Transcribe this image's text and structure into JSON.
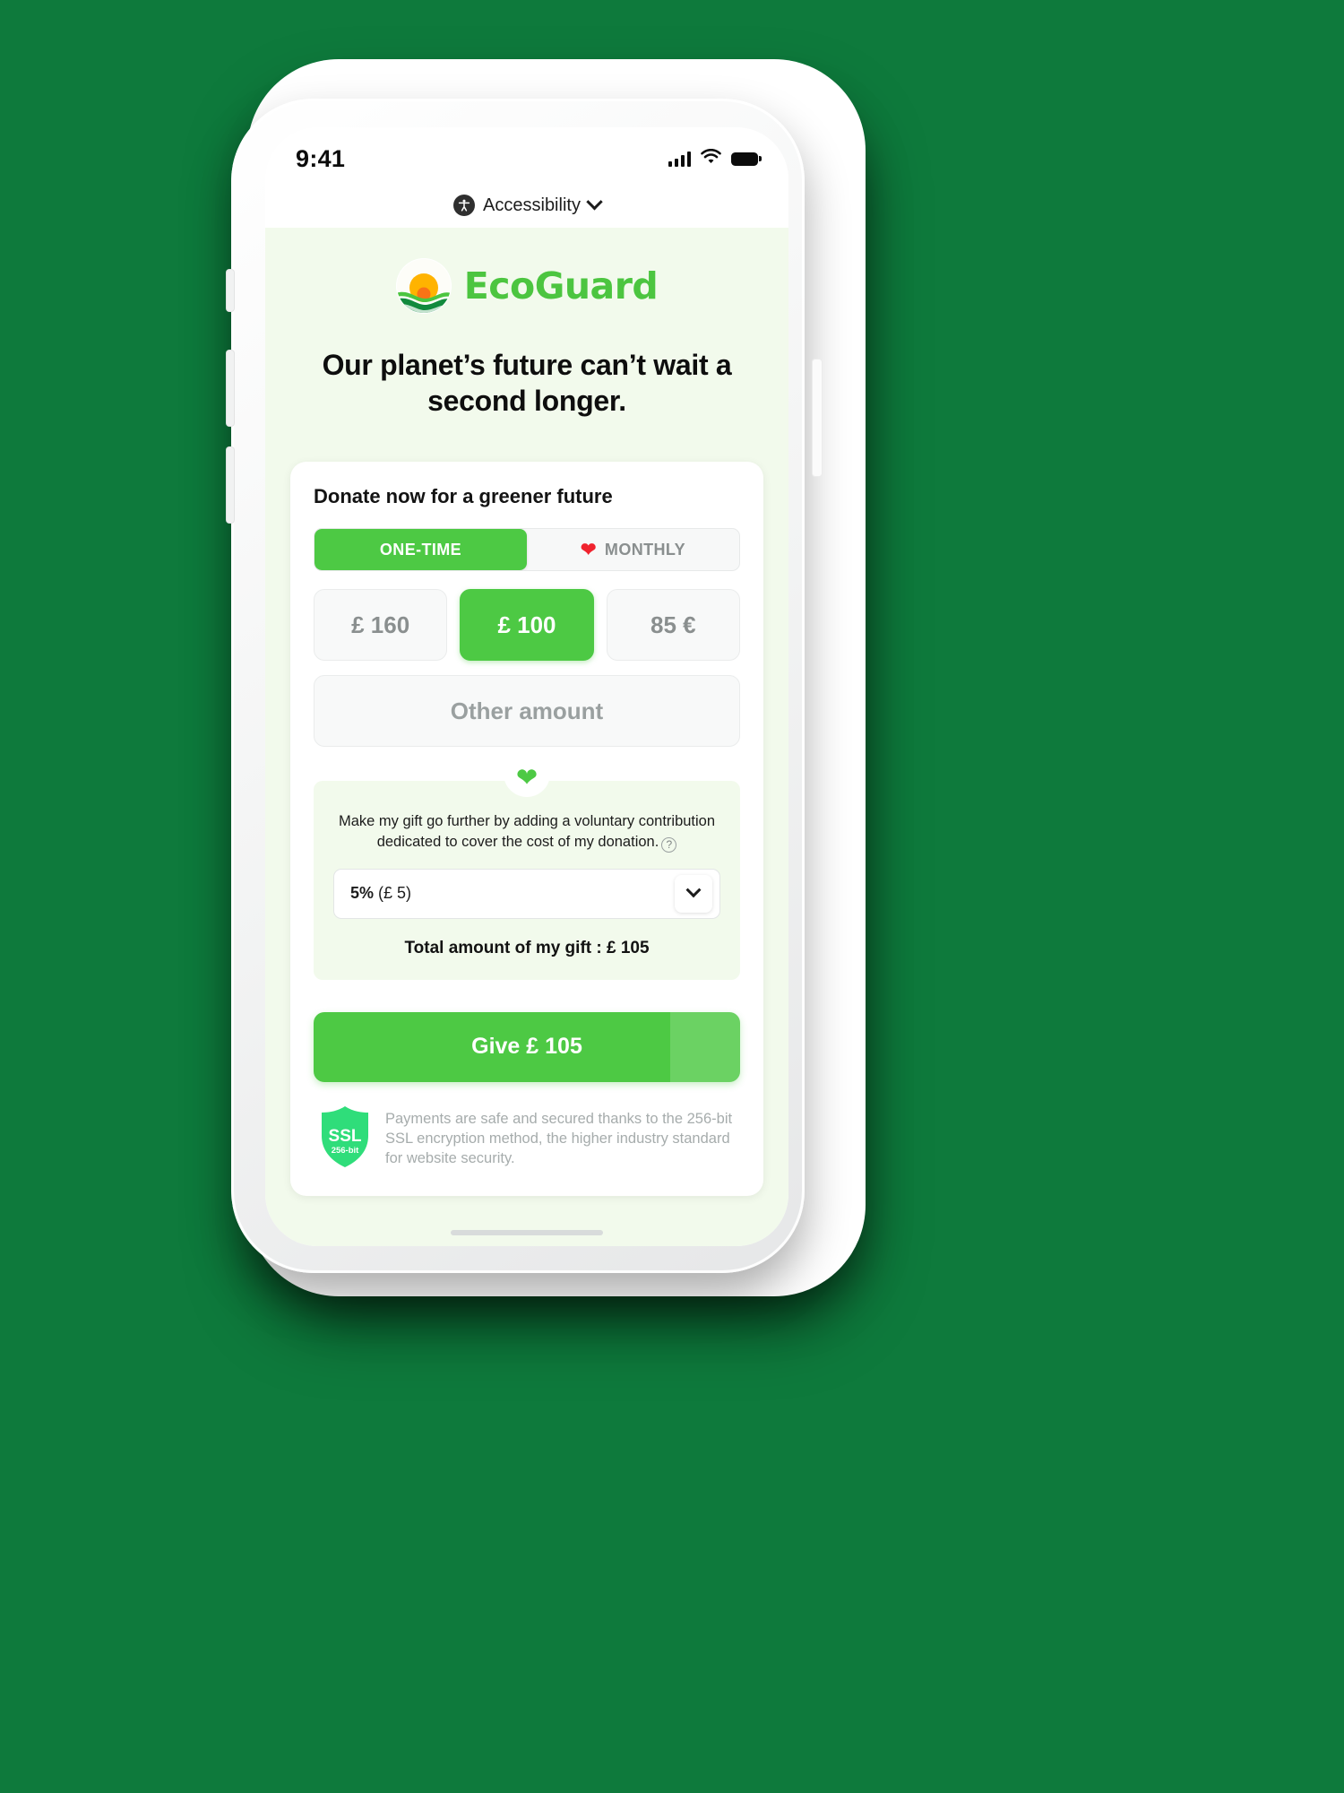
{
  "status_bar": {
    "time": "9:41",
    "icons": [
      "cellular-signal-icon",
      "wifi-icon",
      "battery-icon"
    ]
  },
  "a11y_bar": {
    "icon": "accessibility-icon",
    "label": "Accessibility",
    "chevron": "chevron-down-icon"
  },
  "brand": {
    "name": "EcoGuard",
    "mark": "sun-over-hills-logo-icon",
    "colors": {
      "green": "#4cc540",
      "sun_yellow": "#ffb300",
      "sun_orange": "#f97316",
      "hill_dark": "#1e9e4a",
      "hill_light": "#4cc540"
    }
  },
  "headline": "Our planet’s future can’t wait a second longer.",
  "card": {
    "title": "Donate now for a greener future",
    "frequency": {
      "options": [
        {
          "label": "ONE-TIME",
          "selected": true,
          "icon": null
        },
        {
          "label": "MONTHLY",
          "selected": false,
          "icon": "heart-icon"
        }
      ]
    },
    "amounts": [
      {
        "label": "£ 160",
        "selected": false
      },
      {
        "label": "£ 100",
        "selected": true
      },
      {
        "label": "85 €",
        "selected": false
      }
    ],
    "other_amount_placeholder": "Other amount",
    "contribution": {
      "heart_icon": "heart-icon",
      "text": "Make my gift go further by adding a voluntary contribution dedicated to cover the cost of my donation.",
      "help_icon": "question-mark-icon",
      "select_percent": "5%",
      "select_amount": "(£ 5)",
      "select_chevron": "chevron-down-icon",
      "total_label": "Total amount of my gift : £ 105"
    },
    "submit_label": "Give £ 105",
    "ssl": {
      "badge_title": "SSL",
      "badge_sub": "256-bit",
      "text": "Payments are safe and secured thanks to the 256-bit SSL encryption method, the higher industry standard for website security."
    }
  },
  "theme": {
    "accent_green": "#4dc944",
    "page_bg": "#f2faec",
    "card_bg": "#ffffff",
    "muted_text": "#8a8f8f"
  }
}
